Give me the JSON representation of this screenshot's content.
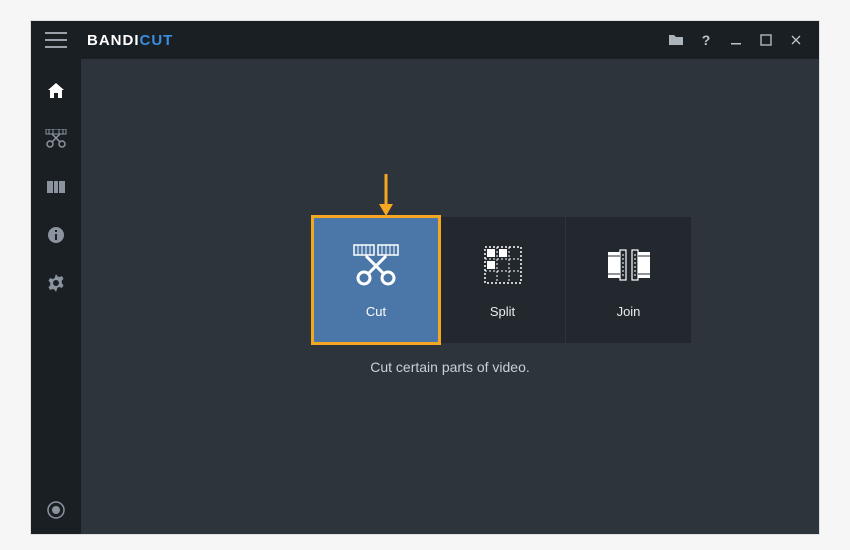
{
  "app": {
    "logo_primary": "BANDI",
    "logo_accent": "CUT"
  },
  "titlebar": {
    "open_tooltip": "Open",
    "help_tooltip": "Help",
    "minimize_tooltip": "Minimize",
    "maximize_tooltip": "Maximize",
    "close_tooltip": "Close"
  },
  "sidebar": [
    {
      "name": "home",
      "active": true
    },
    {
      "name": "cut",
      "active": false
    },
    {
      "name": "split",
      "active": false
    },
    {
      "name": "info",
      "active": false
    },
    {
      "name": "settings",
      "active": false
    }
  ],
  "tiles": [
    {
      "id": "cut",
      "label": "Cut",
      "selected": true
    },
    {
      "id": "split",
      "label": "Split",
      "selected": false
    },
    {
      "id": "join",
      "label": "Join",
      "selected": false
    }
  ],
  "subtitle": "Cut certain parts of video.",
  "annotation_arrow_color": "#f5a623",
  "accent_color": "#4a77a8"
}
